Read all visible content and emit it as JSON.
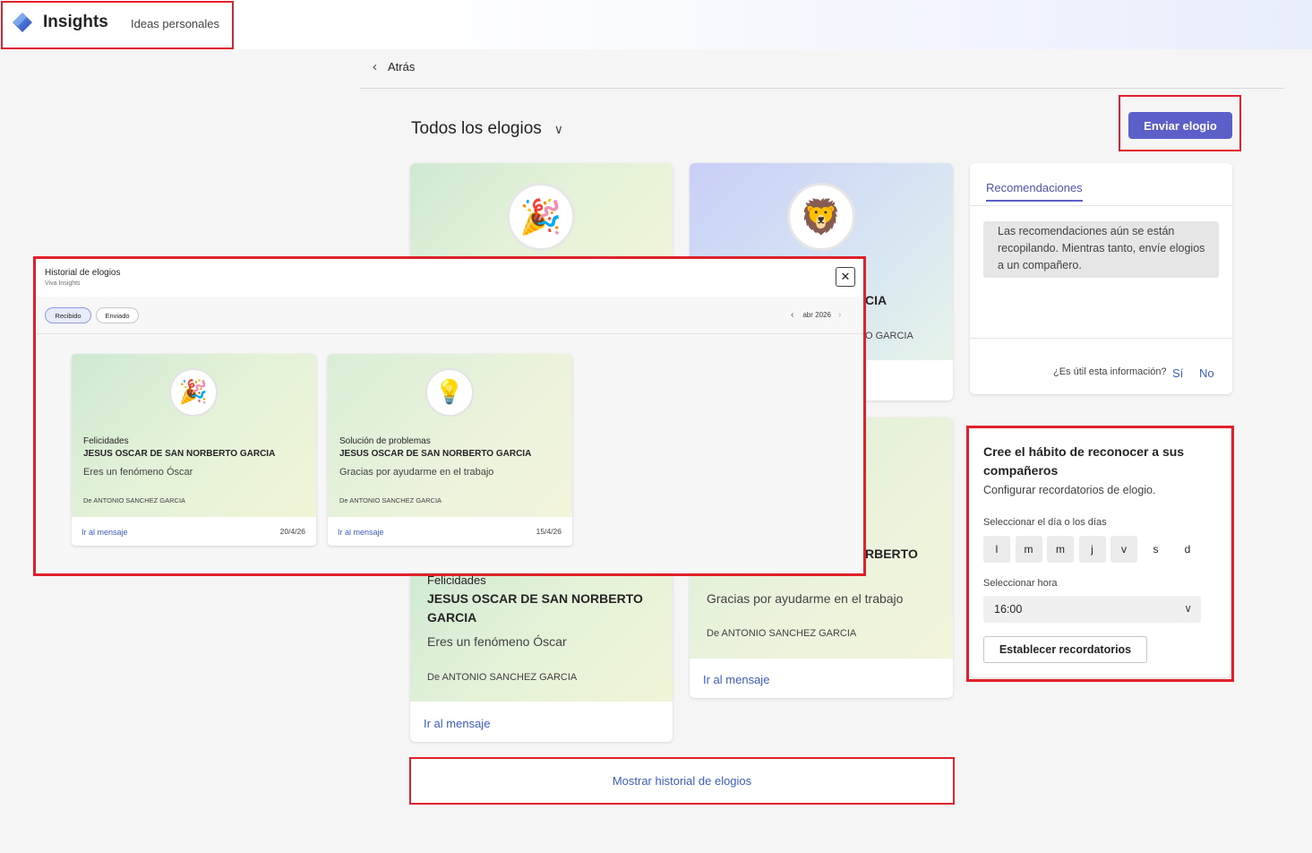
{
  "header": {
    "app_name": "Insights",
    "section": "Ideas personales"
  },
  "nav": {
    "back_label": "Atrás"
  },
  "main": {
    "filter_title": "Todos los elogios",
    "send_button": "Enviar elogio",
    "cards": [
      {
        "icon": "party-popper-icon",
        "category": "Felicidades",
        "recipient": "JESUS OSCAR DE SAN NORBERTO GARCIA",
        "message": "Eres un fenómeno Óscar",
        "from": "De ANTONIO SANCHEZ GARCIA",
        "link": "Ir al mensaje"
      },
      {
        "icon": "lion-icon",
        "recipient_partial_1": "CIA",
        "from_partial_1": "O GARCIA",
        "recipient_partial_2": "RBERTO",
        "message": "Gracias por ayudarme en el trabajo",
        "from": "De ANTONIO SANCHEZ GARCIA",
        "link": "Ir al mensaje"
      }
    ],
    "history_link": "Mostrar historial de elogios"
  },
  "recommendations": {
    "tab": "Recomendaciones",
    "message": "Las recomendaciones aún se están recopilando. Mientras tanto, envíe elogios a un compañero.",
    "question": "¿Es útil esta información?",
    "yes": "Sí",
    "no": "No"
  },
  "habit": {
    "title": "Cree el hábito de reconocer a sus compañeros",
    "subtitle": "Configurar recordatorios de elogio.",
    "days_label": "Seleccionar el día o los días",
    "days": [
      "l",
      "m",
      "m",
      "j",
      "v",
      "s",
      "d"
    ],
    "days_active": [
      true,
      true,
      true,
      true,
      true,
      false,
      false
    ],
    "time_label": "Seleccionar hora",
    "time_value": "16:00",
    "set_button": "Establecer recordatorios"
  },
  "modal": {
    "title": "Historial de elogios",
    "subtitle": "Viva Insights",
    "tab_received": "Recibido",
    "tab_sent": "Enviado",
    "month": "abr 2026",
    "cards": [
      {
        "icon": "party-popper-icon",
        "category": "Felicidades",
        "recipient": "JESUS OSCAR DE SAN NORBERTO GARCIA",
        "message": "Eres un fenómeno Óscar",
        "from": "De ANTONIO SANCHEZ GARCIA",
        "link": "Ir al mensaje",
        "date": "20/4/26"
      },
      {
        "icon": "lightbulb-icon",
        "category": "Solución de problemas",
        "recipient": "JESUS OSCAR DE SAN NORBERTO GARCIA",
        "message": "Gracias por ayudarme en el trabajo",
        "from": "De ANTONIO SANCHEZ GARCIA",
        "link": "Ir al mensaje",
        "date": "15/4/26"
      }
    ]
  },
  "colors": {
    "accent": "#5b5fc7",
    "link": "#3b5cc4",
    "highlight": "#e0202b"
  }
}
